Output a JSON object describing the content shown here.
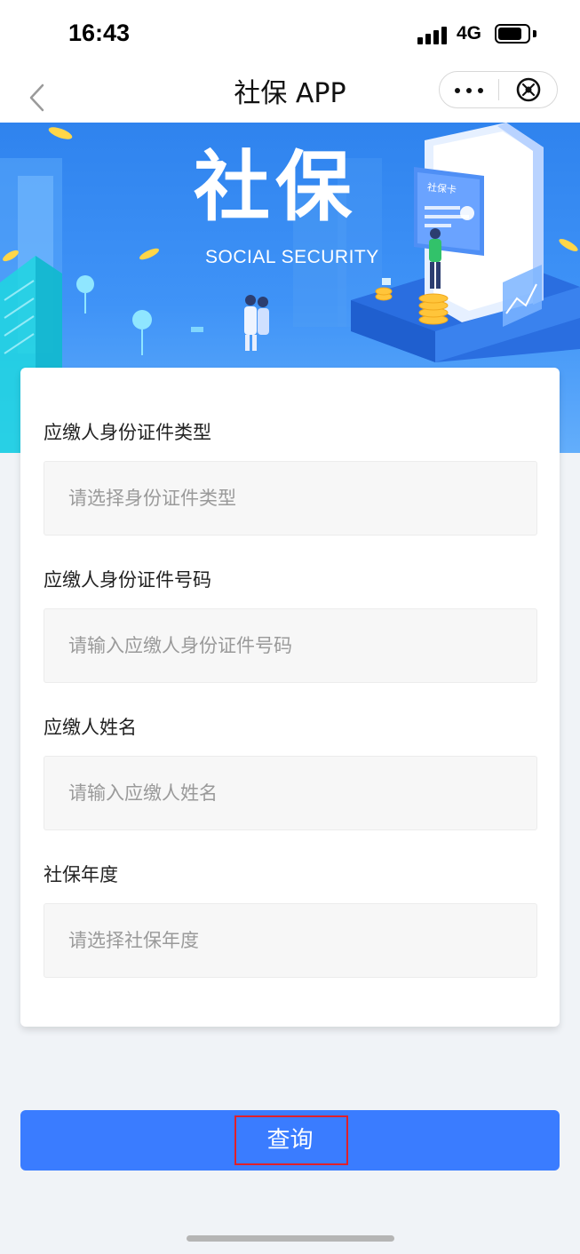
{
  "status_bar": {
    "time": "16:43",
    "network": "4G",
    "icons": [
      "signal-icon",
      "battery-icon"
    ]
  },
  "nav": {
    "title": "社保 APP",
    "icons": [
      "back-icon",
      "more-icon",
      "close-miniapp-icon"
    ]
  },
  "banner": {
    "title": "社保",
    "subtitle": "SOCIAL SECURITY",
    "card_label": "社保卡"
  },
  "form": {
    "fields": [
      {
        "label": "应缴人身份证件类型",
        "placeholder": "请选择身份证件类型"
      },
      {
        "label": "应缴人身份证件号码",
        "placeholder": "请输入应缴人身份证件号码"
      },
      {
        "label": "应缴人姓名",
        "placeholder": "请输入应缴人姓名"
      },
      {
        "label": "社保年度",
        "placeholder": "请选择社保年度"
      }
    ]
  },
  "actions": {
    "query_label": "查询"
  },
  "colors": {
    "primary": "#3a7cff",
    "highlight": "#e0202a",
    "banner": "#3f93f7"
  }
}
